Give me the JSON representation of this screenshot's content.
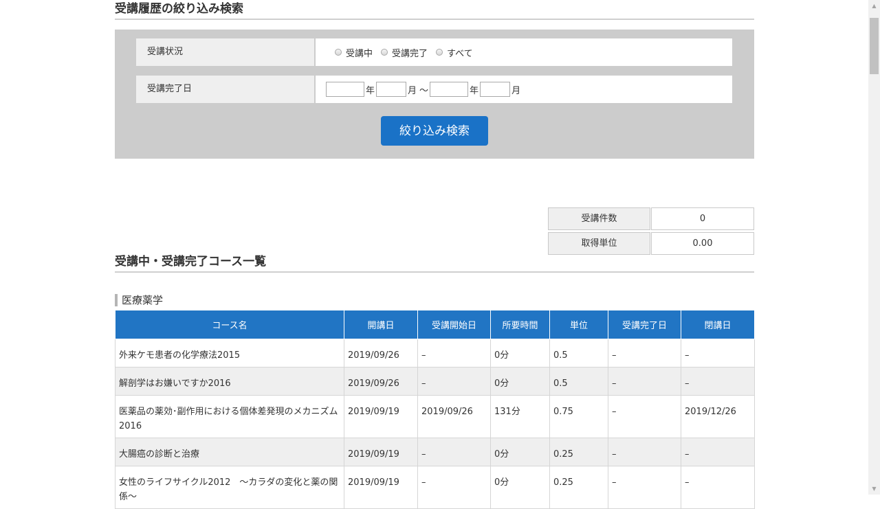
{
  "filter": {
    "title": "受講履歴の絞り込み検索",
    "status_label": "受講状況",
    "status_options": [
      "受講中",
      "受講完了",
      "すべて"
    ],
    "date_label": "受講完了日",
    "year_unit": "年",
    "month_unit": "月",
    "range_sep": "〜",
    "search_button": "絞り込み検索"
  },
  "summary": {
    "count_label": "受講件数",
    "count_value": "0",
    "credits_label": "取得単位",
    "credits_value": "0.00"
  },
  "course_list": {
    "title": "受講中・受講完了コース一覧",
    "category": "医療薬学",
    "columns": [
      "コース名",
      "開講日",
      "受講開始日",
      "所要時間",
      "単位",
      "受講完了日",
      "閉講日"
    ],
    "rows": [
      [
        "外来ケモ患者の化学療法2015",
        "2019/09/26",
        "–",
        "0分",
        "0.5",
        "–",
        "–"
      ],
      [
        "解剖学はお嫌いですか2016",
        "2019/09/26",
        "–",
        "0分",
        "0.5",
        "–",
        "–"
      ],
      [
        "医薬品の薬効･副作用における個体差発現のメカニズム2016",
        "2019/09/19",
        "2019/09/26",
        "131分",
        "0.75",
        "–",
        "2019/12/26"
      ],
      [
        "大腸癌の診断と治療",
        "2019/09/19",
        "–",
        "0分",
        "0.25",
        "–",
        "–"
      ],
      [
        "女性のライフサイクル2012　～カラダの変化と薬の関係～",
        "2019/09/19",
        "–",
        "0分",
        "0.25",
        "–",
        "–"
      ]
    ]
  }
}
